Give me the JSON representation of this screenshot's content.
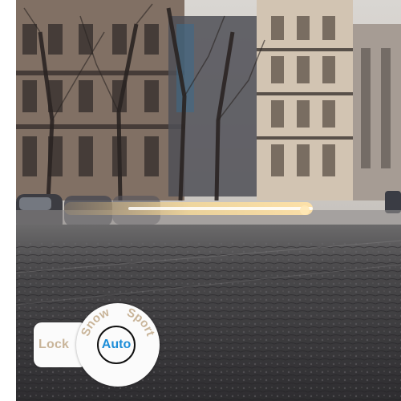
{
  "modes": {
    "lock_label": "Lock",
    "snow_label": "Snow",
    "sport_label": "Sport",
    "auto_label": "Auto",
    "selected": "Auto"
  },
  "colors": {
    "inactive_label": "#c9b59a",
    "active_label": "#1e8ed8",
    "ring": "#111111",
    "panel": "#fbfbfb"
  }
}
